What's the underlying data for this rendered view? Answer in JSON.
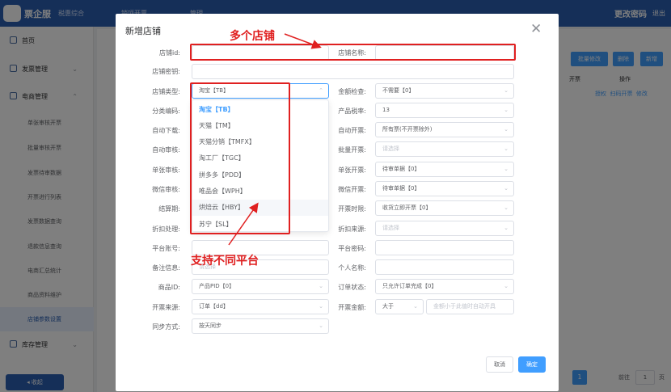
{
  "topbar": {
    "brand": "票企服",
    "subbrand": "税惠综合",
    "nav1": "销项开票",
    "nav2": "管理",
    "change_pwd": "更改密码",
    "logout": "退出"
  },
  "sidebar": {
    "home": "首页",
    "invoice_mgmt": "发票管理",
    "ecommerce_mgmt": "电商管理",
    "sub_items": [
      "单张审核开票",
      "批量审核开票",
      "发票待审数据",
      "开票进行列表",
      "发票数据查询",
      "退款信息查询",
      "电商汇总统计",
      "商品资料维护",
      "店铺参数设置"
    ],
    "stock_mgmt": "库存管理",
    "collapse": "收起"
  },
  "background": {
    "buttons": [
      "批量修改",
      "删除",
      "新增"
    ],
    "col_invoice": "开票",
    "col_action": "操作",
    "row_actions": "授权  扫码开票  修改",
    "page_current": "1",
    "goto_label": "前往",
    "goto_value": "1",
    "page_unit": "页"
  },
  "dialog": {
    "title": "新增店铺",
    "close": "✕",
    "fields": {
      "shop_id": {
        "label": "店铺id:",
        "value": ""
      },
      "shop_name": {
        "label": "店铺名称:",
        "value": ""
      },
      "shop_secret": {
        "label": "店铺密钥:",
        "value": ""
      },
      "shop_type": {
        "label": "店铺类型:",
        "value": "淘宝【TB】"
      },
      "amount_check": {
        "label": "金额检查:",
        "value": "不需要【0】"
      },
      "category_code": {
        "label": "分类编码:",
        "value": ""
      },
      "product_tax": {
        "label": "产品税率:",
        "value": "13"
      },
      "auto_download": {
        "label": "自动下载:",
        "value": ""
      },
      "auto_invoice": {
        "label": "自动开票:",
        "value": "所有票(不开票除外)"
      },
      "auto_audit": {
        "label": "自动审核:",
        "value": ""
      },
      "batch_invoice": {
        "label": "批量开票:",
        "placeholder": "请选择"
      },
      "single_audit": {
        "label": "单张审核:",
        "value": ""
      },
      "single_invoice": {
        "label": "单张开票:",
        "value": "待审单据【0】"
      },
      "wechat_audit": {
        "label": "微信审核:",
        "value": ""
      },
      "wechat_invoice": {
        "label": "微信开票:",
        "value": "待审单据【0】"
      },
      "settlement": {
        "label": "结算期:",
        "value": ""
      },
      "invoice_timing": {
        "label": "开票时限:",
        "value": "收货立即开票【0】"
      },
      "discount_handling": {
        "label": "折扣处理:",
        "value": ""
      },
      "discount_source": {
        "label": "折扣来源:",
        "placeholder": "请选择"
      },
      "platform_account": {
        "label": "平台账号:",
        "value": ""
      },
      "platform_password": {
        "label": "平台密码:",
        "value": ""
      },
      "remark": {
        "label": "备注信息:",
        "placeholder": "请选择"
      },
      "personal_name": {
        "label": "个人名称:",
        "value": ""
      },
      "product_id": {
        "label": "商品ID:",
        "value": "产品PID【0】"
      },
      "order_status": {
        "label": "订单状态:",
        "value": "只允许订单完成【0】"
      },
      "invoice_source": {
        "label": "开票来源:",
        "value": "订单【dd】"
      },
      "invoice_amount": {
        "label": "开票金额:",
        "op": "大于",
        "placeholder": "金额小于此值时自动开具"
      },
      "sync_mode": {
        "label": "同步方式:",
        "value": "按天同步"
      }
    },
    "dropdown_options": [
      "淘宝【TB】",
      "天猫【TM】",
      "天猫分销【TMFX】",
      "淘工厂【TGC】",
      "拼多多【PDD】",
      "唯品会【WPH】",
      "烘焙云【HBY】",
      "苏宁【SL】"
    ],
    "cancel": "取消",
    "confirm": "确定"
  },
  "annotations": {
    "multi_shop": "多个店铺",
    "multi_platform": "支持不同平台"
  },
  "colors": {
    "brand_blue": "#2a5fb0",
    "primary": "#409eff",
    "annotation_red": "#e02020"
  }
}
